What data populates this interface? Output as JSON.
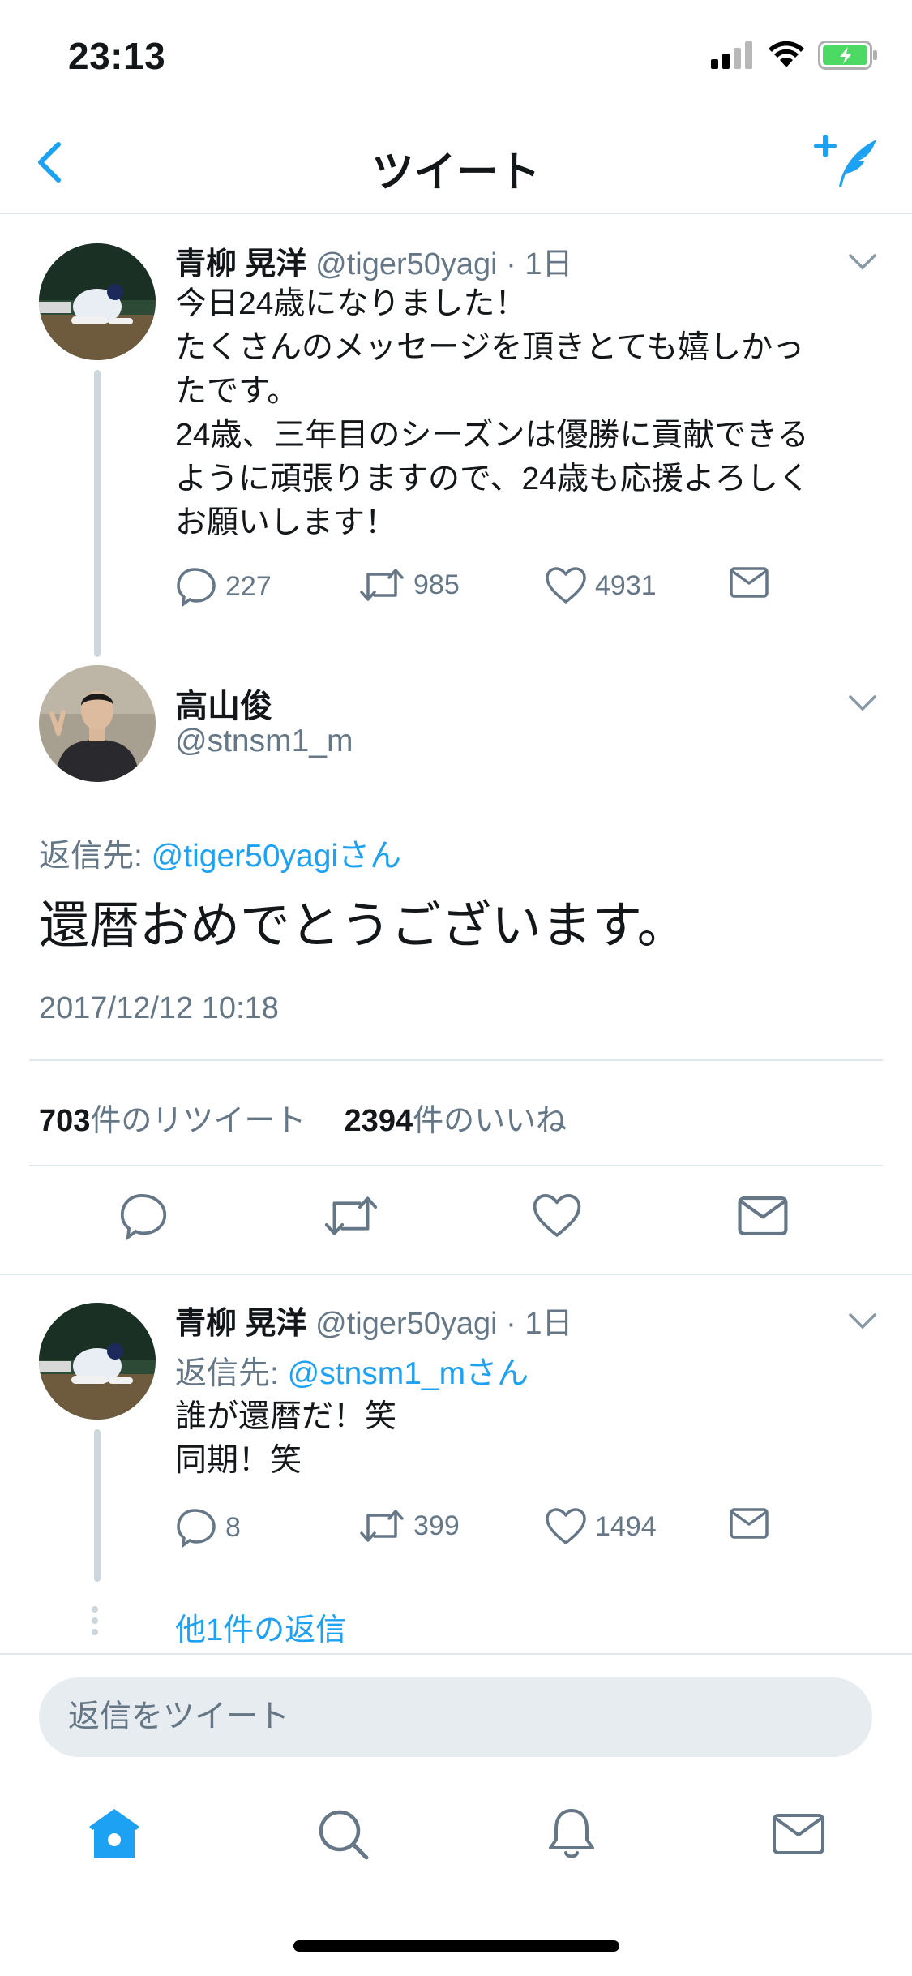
{
  "status_bar": {
    "time": "23:13"
  },
  "navbar": {
    "title": "ツイート"
  },
  "tweets": [
    {
      "display_name": "青柳 晃洋",
      "handle_time": "@tiger50yagi · 1日",
      "text": "今日24歳になりました！\nたくさんのメッセージを頂きとても嬉しかっ\nたです。\n24歳、三年目のシーズンは優勝に貢献できる\nように頑張りますので、24歳も応援よろしく\nお願いします！",
      "replies": "227",
      "retweets": "985",
      "likes": "4931"
    },
    {
      "display_name": "青柳 晃洋",
      "handle_time": "@tiger50yagi · 1日",
      "reply_prefix": "返信先: ",
      "reply_mention": "@stnsm1_mさん",
      "text": "誰が還暦だ！笑\n同期！笑",
      "replies": "8",
      "retweets": "399",
      "likes": "1494"
    }
  ],
  "focused": {
    "display_name": "高山俊",
    "handle": "@stnsm1_m",
    "reply_prefix": "返信先: ",
    "reply_mention": "@tiger50yagiさん",
    "text": "還暦おめでとうございます。",
    "timestamp": "2017/12/12 10:18",
    "retweet_count": "703",
    "retweet_label": "件のリツイート",
    "like_count": "2394",
    "like_label": "件のいいね"
  },
  "more_replies": "他1件の返信",
  "reply_bar": {
    "placeholder": "返信をツイート"
  },
  "colors": {
    "accent": "#1da1f2",
    "secondary_text": "#657786",
    "divider": "#e1e8ed",
    "battery": "#4cd964"
  },
  "icons": [
    "back-chevron-icon",
    "compose-feather-icon",
    "reply-icon",
    "retweet-icon",
    "like-icon",
    "direct-message-icon",
    "home-icon",
    "search-icon",
    "notifications-icon",
    "messages-icon"
  ]
}
